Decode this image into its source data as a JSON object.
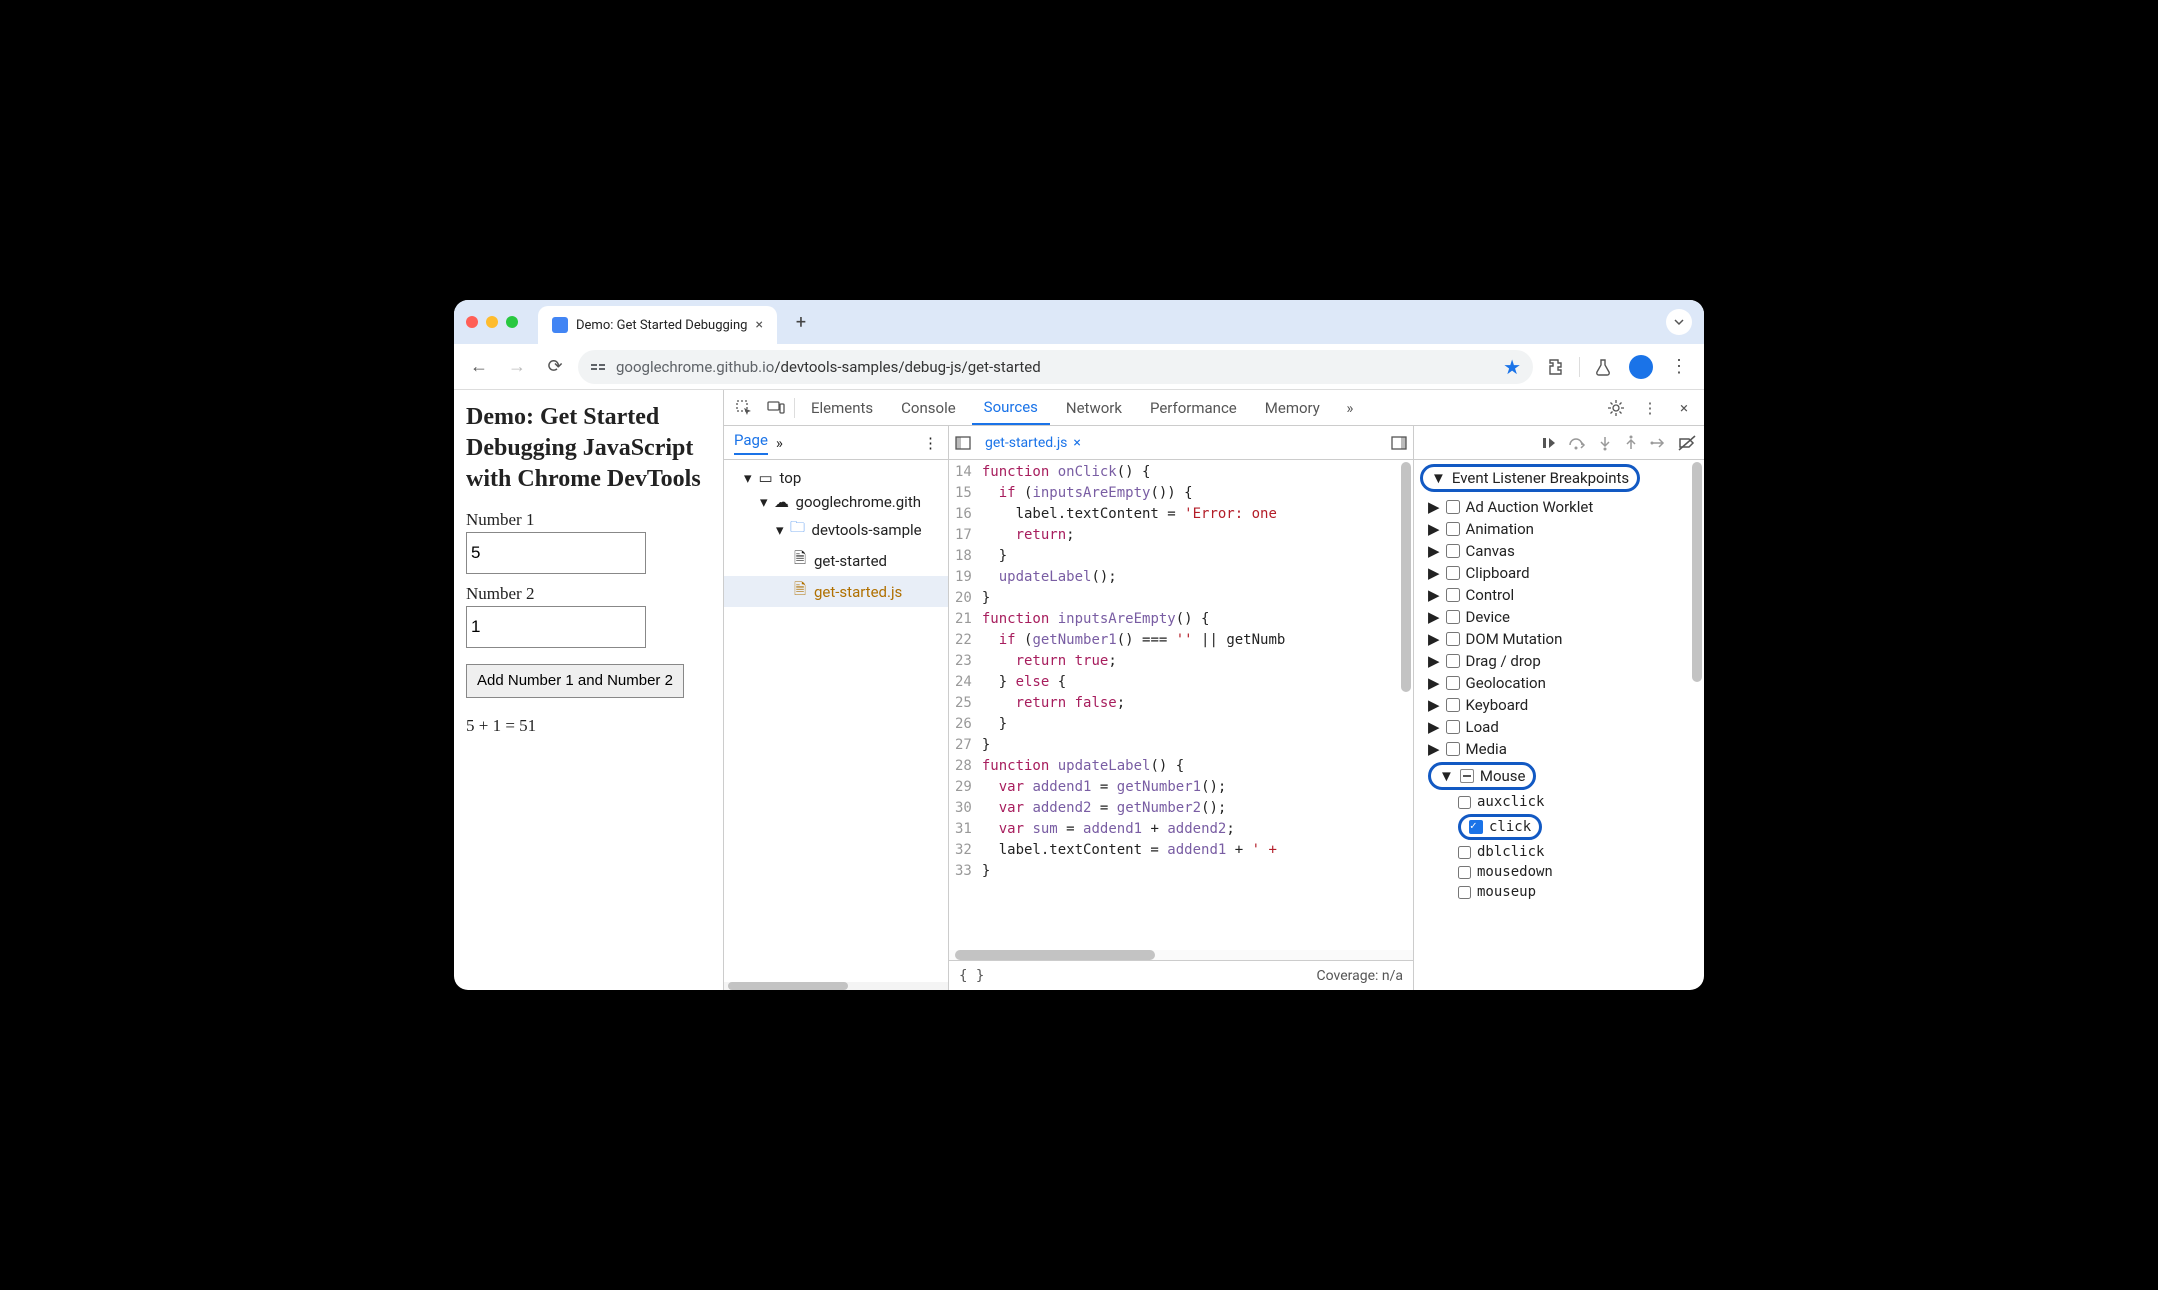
{
  "browser": {
    "tab_title": "Demo: Get Started Debugging",
    "url_host": "googlechrome.github.io",
    "url_path": "/devtools-samples/debug-js/get-started"
  },
  "page": {
    "heading": "Demo: Get Started Debugging JavaScript with Chrome DevTools",
    "label1": "Number 1",
    "input1": "5",
    "label2": "Number 2",
    "input2": "1",
    "button": "Add Number 1 and Number 2",
    "result": "5 + 1 = 51"
  },
  "devtools": {
    "tabs": [
      "Elements",
      "Console",
      "Sources",
      "Network",
      "Performance",
      "Memory"
    ],
    "active_tab": "Sources",
    "navigator": {
      "tab": "Page",
      "tree": {
        "top": "top",
        "domain": "googlechrome.gith",
        "folder": "devtools-sample",
        "file_html": "get-started",
        "file_js": "get-started.js"
      }
    },
    "editor": {
      "open_file": "get-started.js",
      "first_line": 14,
      "lines": [
        "function onClick() {",
        "  if (inputsAreEmpty()) {",
        "    label.textContent = 'Error: one",
        "    return;",
        "  }",
        "  updateLabel();",
        "}",
        "function inputsAreEmpty() {",
        "  if (getNumber1() === '' || getNumb",
        "    return true;",
        "  } else {",
        "    return false;",
        "  }",
        "}",
        "function updateLabel() {",
        "  var addend1 = getNumber1();",
        "  var addend2 = getNumber2();",
        "  var sum = addend1 + addend2;",
        "  label.textContent = addend1 + ' +",
        "}"
      ],
      "coverage": "Coverage: n/a"
    },
    "breakpoints": {
      "section": "Event Listener Breakpoints",
      "categories": [
        {
          "name": "Ad Auction Worklet",
          "expanded": false,
          "checked": false
        },
        {
          "name": "Animation",
          "expanded": false,
          "checked": false
        },
        {
          "name": "Canvas",
          "expanded": false,
          "checked": false
        },
        {
          "name": "Clipboard",
          "expanded": false,
          "checked": false
        },
        {
          "name": "Control",
          "expanded": false,
          "checked": false
        },
        {
          "name": "Device",
          "expanded": false,
          "checked": false
        },
        {
          "name": "DOM Mutation",
          "expanded": false,
          "checked": false
        },
        {
          "name": "Drag / drop",
          "expanded": false,
          "checked": false
        },
        {
          "name": "Geolocation",
          "expanded": false,
          "checked": false
        },
        {
          "name": "Keyboard",
          "expanded": false,
          "checked": false
        },
        {
          "name": "Load",
          "expanded": false,
          "checked": false
        },
        {
          "name": "Media",
          "expanded": false,
          "checked": false
        },
        {
          "name": "Mouse",
          "expanded": true,
          "checked": "indeterminate",
          "children": [
            {
              "name": "auxclick",
              "checked": false
            },
            {
              "name": "click",
              "checked": true
            },
            {
              "name": "dblclick",
              "checked": false
            },
            {
              "name": "mousedown",
              "checked": false
            },
            {
              "name": "mouseup",
              "checked": false
            }
          ]
        }
      ]
    }
  }
}
